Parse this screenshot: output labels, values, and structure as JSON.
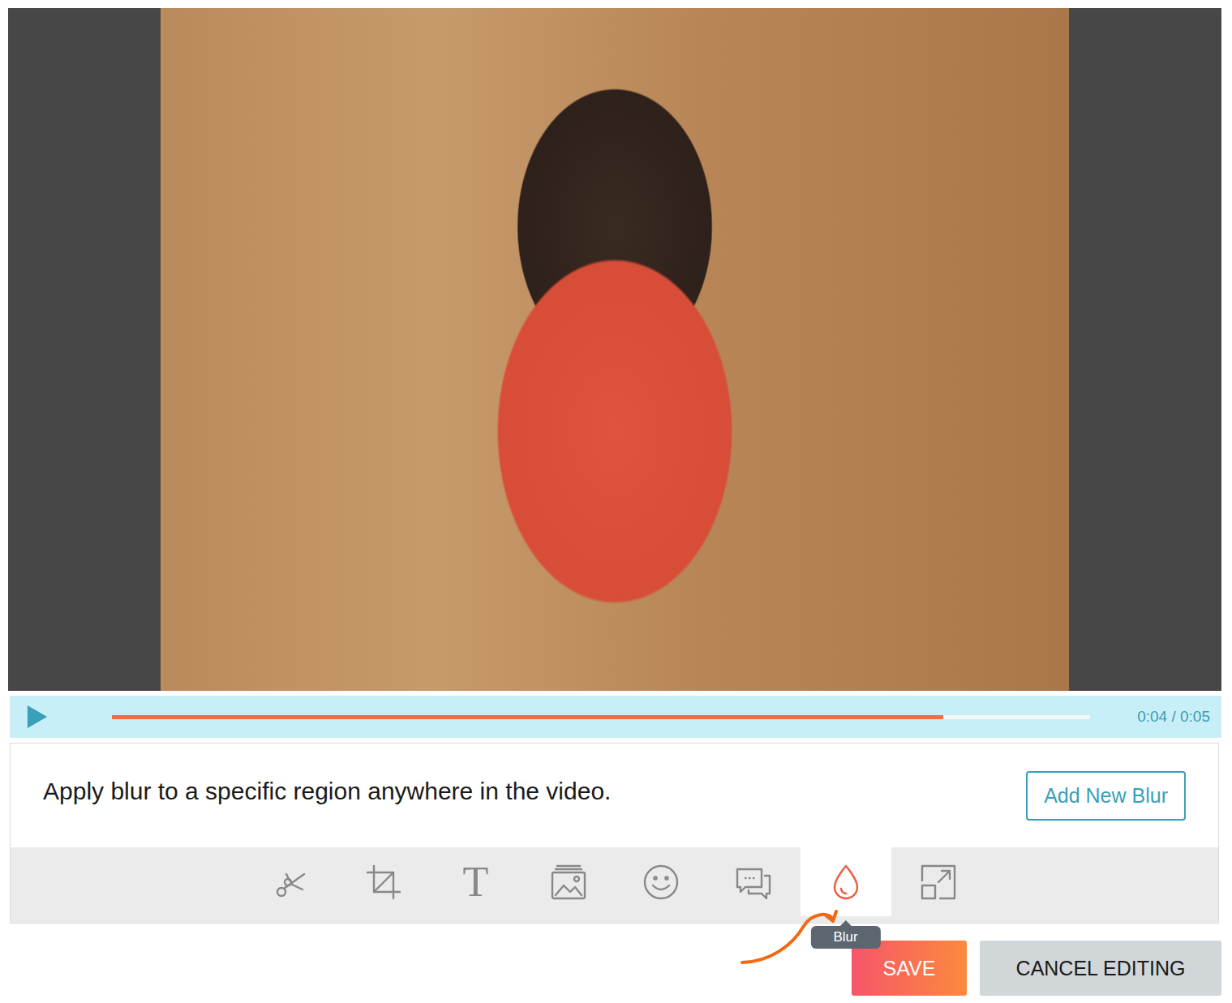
{
  "player": {
    "playing": false,
    "level": 0.85,
    "time": "0:04 / 0:05"
  },
  "blur_panel": {
    "description": "Apply blur to a specific region anywhere in the video.",
    "button": "Add New Blur"
  },
  "tools": [
    {
      "kind": "scissors",
      "selected": false
    },
    {
      "kind": "crop",
      "selected": false
    },
    {
      "kind": "text",
      "glyph": "T",
      "selected": false
    },
    {
      "kind": "image",
      "selected": false
    },
    {
      "kind": "emoji",
      "selected": false
    },
    {
      "kind": "callout",
      "selected": false
    },
    {
      "kind": "blur",
      "selected": true,
      "tooltip": "Blur"
    },
    {
      "kind": "resize",
      "selected": false
    }
  ],
  "buttons": [
    {
      "label": "SAVE",
      "kind": "primary"
    },
    {
      "label": "CANCEL EDITING",
      "kind": "secondary"
    }
  ]
}
